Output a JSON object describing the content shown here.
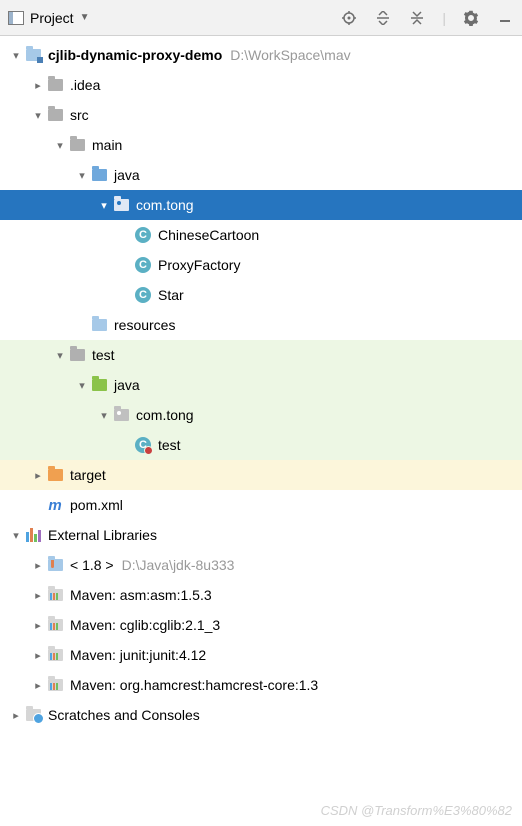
{
  "header": {
    "title": "Project"
  },
  "tree": [
    {
      "indent": 0,
      "arrow": "down",
      "iconType": "module",
      "label": "cjlib-dynamic-proxy-demo",
      "bold": true,
      "extra": "D:\\WorkSpace\\mav",
      "name": "project-root"
    },
    {
      "indent": 1,
      "arrow": "right",
      "iconType": "folder-gray",
      "label": ".idea",
      "name": "folder-idea"
    },
    {
      "indent": 1,
      "arrow": "down",
      "iconType": "folder-gray",
      "label": "src",
      "name": "folder-src"
    },
    {
      "indent": 2,
      "arrow": "down",
      "iconType": "folder-gray",
      "label": "main",
      "name": "folder-main"
    },
    {
      "indent": 3,
      "arrow": "down",
      "iconType": "folder-blue",
      "label": "java",
      "name": "folder-java-main"
    },
    {
      "indent": 4,
      "arrow": "down",
      "iconType": "package",
      "label": "com.tong",
      "selected": true,
      "name": "package-com-tong"
    },
    {
      "indent": 5,
      "arrow": "none",
      "iconType": "class",
      "label": "ChineseCartoon",
      "name": "class-chinesecartoon"
    },
    {
      "indent": 5,
      "arrow": "none",
      "iconType": "class",
      "label": "ProxyFactory",
      "name": "class-proxyfactory"
    },
    {
      "indent": 5,
      "arrow": "none",
      "iconType": "class",
      "label": "Star",
      "name": "class-star"
    },
    {
      "indent": 3,
      "arrow": "none",
      "iconType": "folder-lightblue",
      "label": "resources",
      "name": "folder-resources"
    },
    {
      "indent": 2,
      "arrow": "down",
      "iconType": "folder-gray",
      "label": "test",
      "rowClass": "changed-green",
      "name": "folder-test"
    },
    {
      "indent": 3,
      "arrow": "down",
      "iconType": "folder-green",
      "label": "java",
      "rowClass": "changed-green",
      "name": "folder-java-test"
    },
    {
      "indent": 4,
      "arrow": "down",
      "iconType": "package",
      "label": "com.tong",
      "rowClass": "changed-green",
      "name": "package-com-tong-test"
    },
    {
      "indent": 5,
      "arrow": "none",
      "iconType": "class-test",
      "label": "test",
      "rowClass": "changed-green",
      "name": "class-test"
    },
    {
      "indent": 1,
      "arrow": "right",
      "iconType": "folder-orange",
      "label": "target",
      "rowClass": "changed-yellow",
      "name": "folder-target"
    },
    {
      "indent": 1,
      "arrow": "none",
      "iconType": "maven",
      "label": "pom.xml",
      "name": "file-pom"
    },
    {
      "indent": 0,
      "arrow": "down",
      "iconType": "libs",
      "label": "External Libraries",
      "name": "external-libraries"
    },
    {
      "indent": 1,
      "arrow": "right",
      "iconType": "jdk",
      "label": "< 1.8 >",
      "extra": "D:\\Java\\jdk-8u333",
      "name": "lib-jdk"
    },
    {
      "indent": 1,
      "arrow": "right",
      "iconType": "lib",
      "label": "Maven: asm:asm:1.5.3",
      "name": "lib-asm"
    },
    {
      "indent": 1,
      "arrow": "right",
      "iconType": "lib",
      "label": "Maven: cglib:cglib:2.1_3",
      "name": "lib-cglib"
    },
    {
      "indent": 1,
      "arrow": "right",
      "iconType": "lib",
      "label": "Maven: junit:junit:4.12",
      "name": "lib-junit"
    },
    {
      "indent": 1,
      "arrow": "right",
      "iconType": "lib",
      "label": "Maven: org.hamcrest:hamcrest-core:1.3",
      "name": "lib-hamcrest"
    },
    {
      "indent": 0,
      "arrow": "right",
      "iconType": "scratch",
      "label": "Scratches and Consoles",
      "name": "scratches-consoles"
    }
  ],
  "watermark": "CSDN @Transform%E3%80%82"
}
